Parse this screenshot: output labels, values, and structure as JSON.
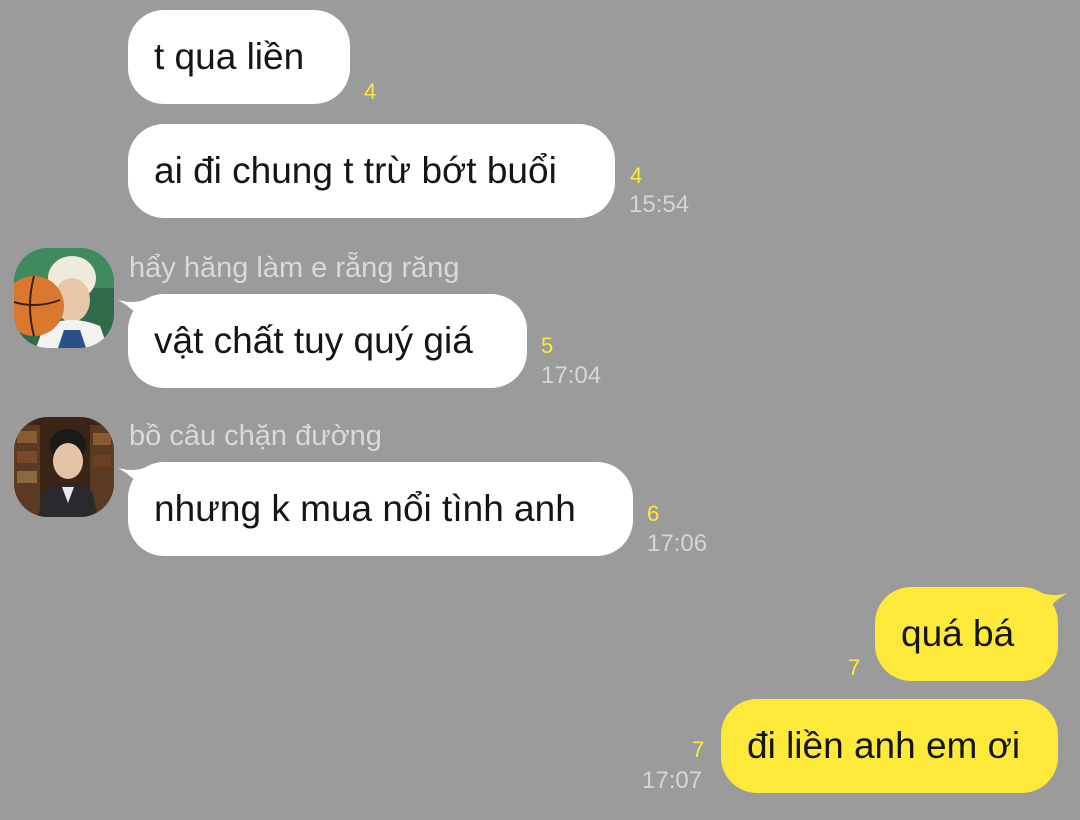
{
  "colors": {
    "background": "#9b9b9b",
    "incoming_bubble": "#ffffff",
    "outgoing_bubble": "#fde93a",
    "unread_count": "#fde93a",
    "timestamp": "#d6d6d6"
  },
  "messages": [
    {
      "text": "t qua liền",
      "unread": "4",
      "time": ""
    },
    {
      "text": "ai đi chung t trừ bớt buổi",
      "unread": "4",
      "time": "15:54"
    },
    {
      "sender": "hẩy hăng làm e rẵng răng",
      "avatar": "basketball-user-avatar",
      "text": "vật chất tuy quý giá",
      "unread": "5",
      "time": "17:04"
    },
    {
      "sender": "bồ câu chặn đường",
      "avatar": "library-user-avatar",
      "text": "nhưng k mua nổi tình anh",
      "unread": "6",
      "time": "17:06"
    },
    {
      "text": "quá bá",
      "unread": "7",
      "time": "",
      "outgoing": true
    },
    {
      "text": "đi liền anh em ơi",
      "unread": "7",
      "time": "17:07",
      "outgoing": true
    }
  ]
}
